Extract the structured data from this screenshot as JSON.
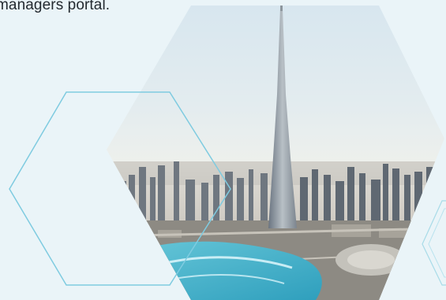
{
  "intro": {
    "text_fragment": "managers portal."
  },
  "hero": {
    "image_subject": "city-skyline-hexagon-image",
    "outline_color": "#6ec6dd",
    "accent_outline_color": "#a8dbe8"
  }
}
